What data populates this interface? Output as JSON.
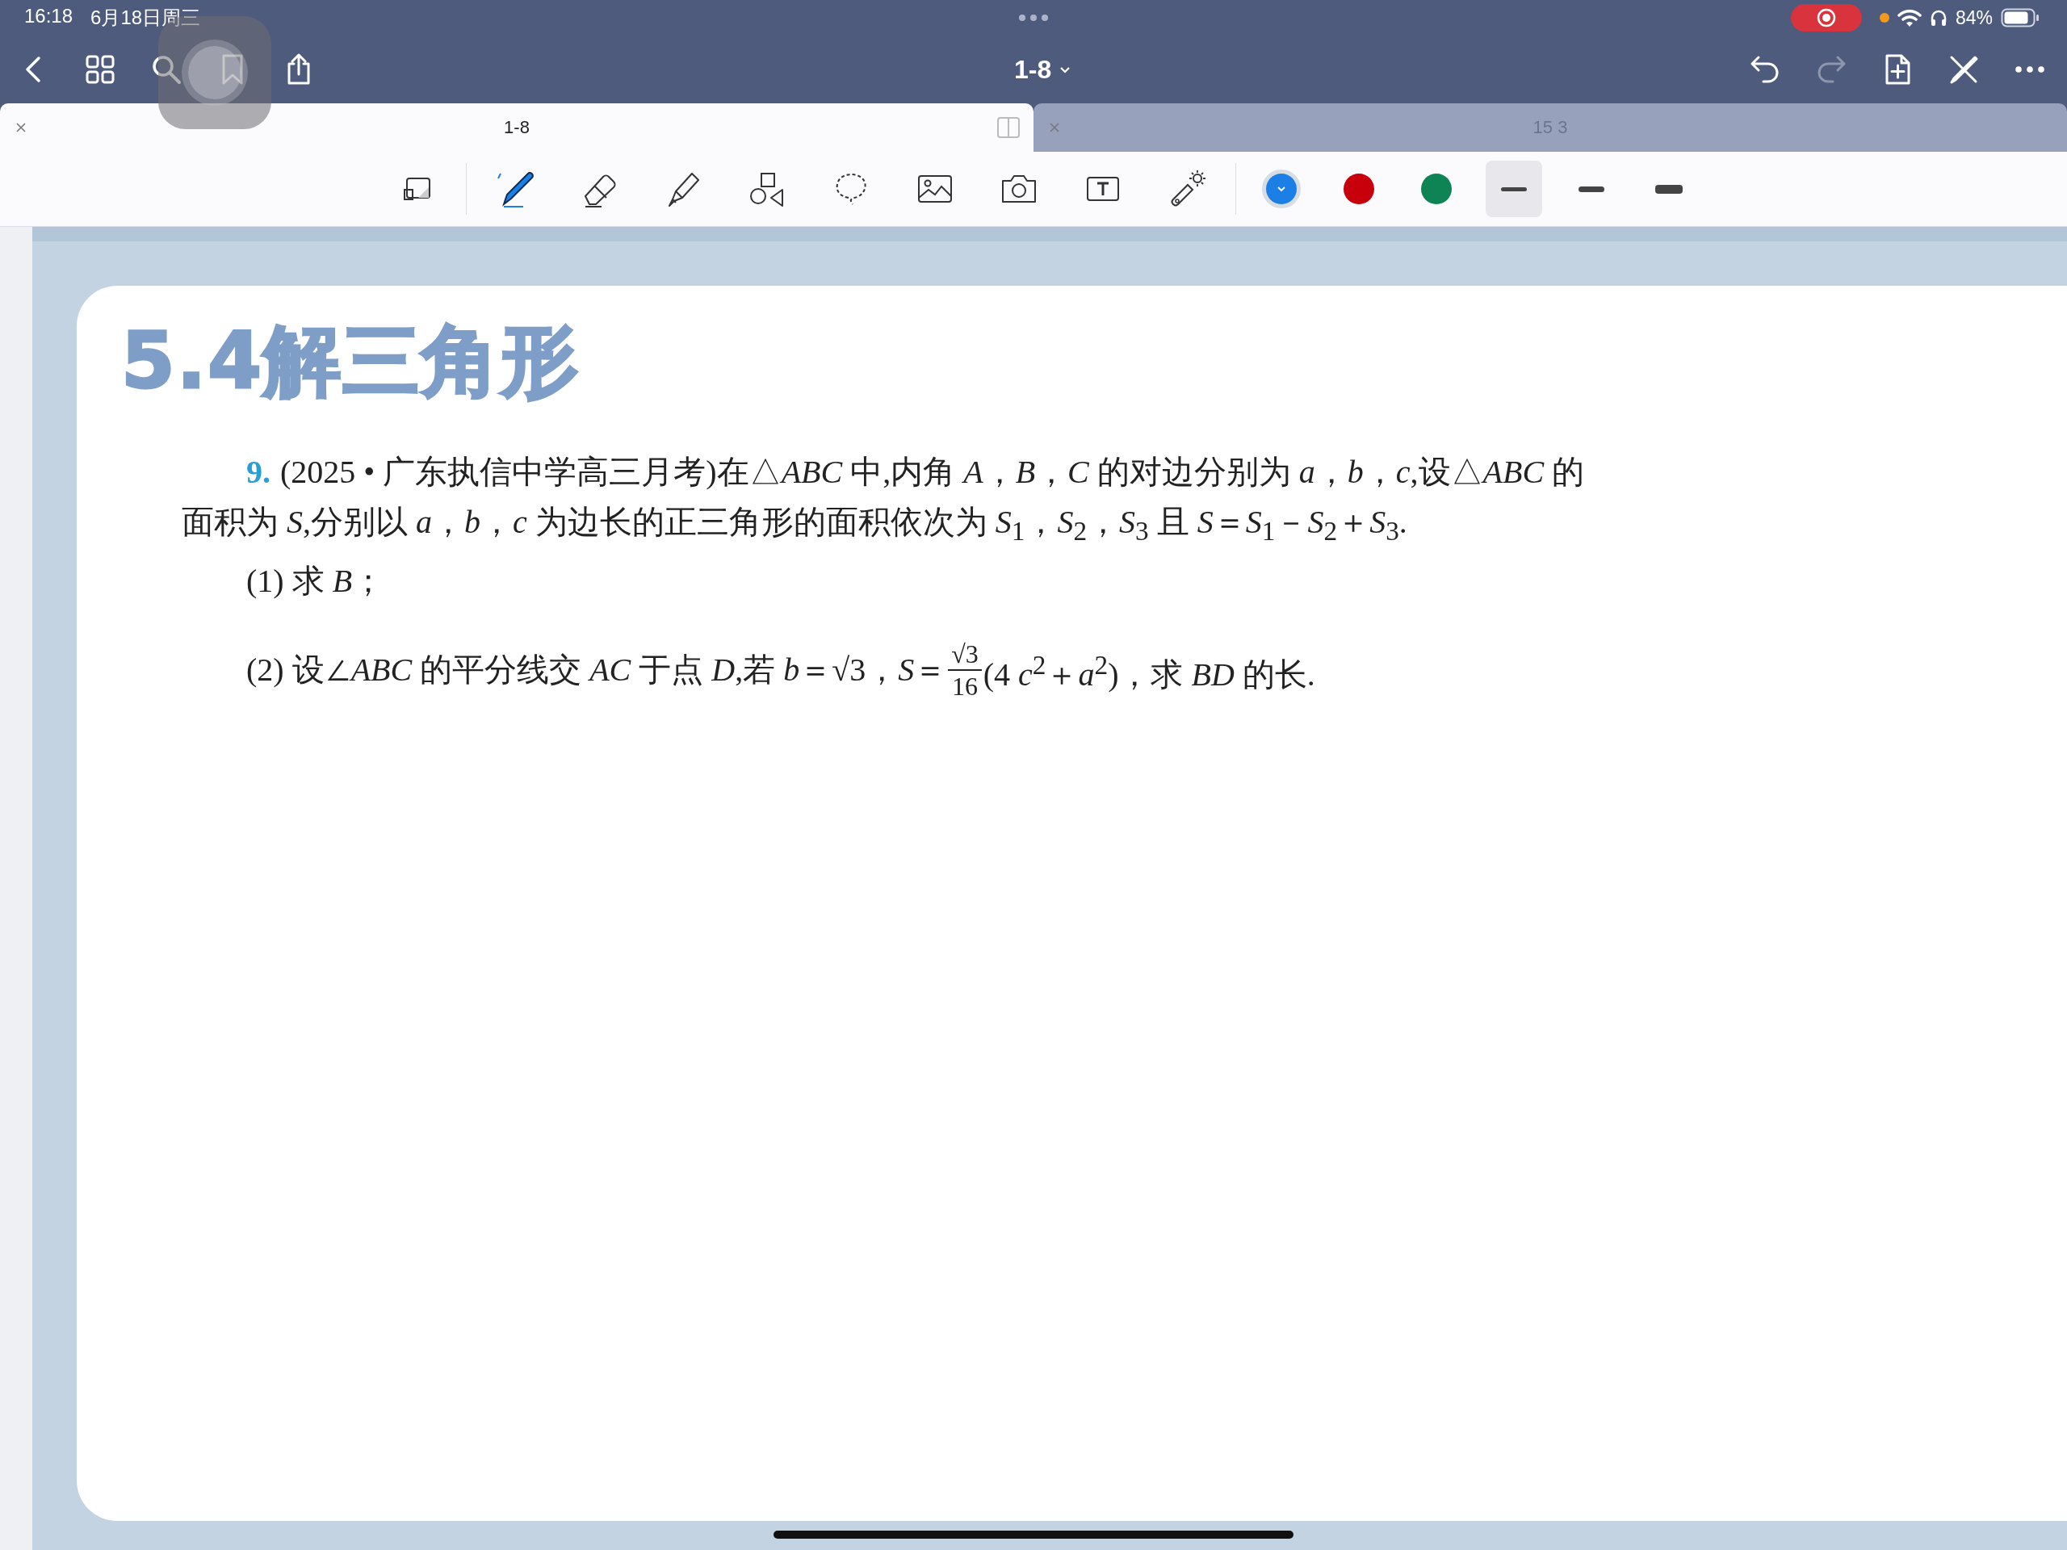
{
  "status_bar": {
    "time": "16:18",
    "date": "6月18日周三",
    "battery": "84%"
  },
  "nav": {
    "title": "1-8",
    "redo": {
      "disabled": true
    }
  },
  "tabs": [
    {
      "label": "1-8",
      "selected": true
    },
    {
      "label": "15 3",
      "selected": false
    }
  ],
  "tools": [
    {
      "kind": "zoom"
    },
    {
      "kind": "pen"
    },
    {
      "kind": "eraser"
    },
    {
      "kind": "highlighter"
    },
    {
      "kind": "shapes"
    },
    {
      "kind": "lasso"
    },
    {
      "kind": "image"
    },
    {
      "kind": "camera"
    },
    {
      "kind": "text"
    },
    {
      "kind": "laser"
    }
  ],
  "colors": [
    {
      "color": "#1b7fe6",
      "selected": true
    },
    {
      "color": "#c8000b",
      "selected": false
    },
    {
      "color": "#0e8454",
      "selected": false
    }
  ],
  "widths": [
    {
      "kind": "thin",
      "selected": true
    },
    {
      "kind": "medium",
      "selected": false
    },
    {
      "kind": "thick",
      "selected": false
    }
  ],
  "page": {
    "title": "5.4解三角形",
    "problem": {
      "number": "9.",
      "lines": [
        "(2025 • 广东执信中学高三月考)在△*ABC* 中,内角 *A*，*B*，*C* 的对边分别为 *a*，*b*，*c*,设△*ABC* 的",
        "面积为 *S*,分别以 *a*，*b*，*c* 为边长的正三角形的面积依次为 *S*$_{1}$，*S*$_{2}$，*S*$_{3}$ 且 *S*＝*S*$_{1}$－*S*$_{2}$＋*S*$_{3}$."
      ],
      "part1": "(1) 求 *B*；",
      "part2": {
        "before": "(2) 设∠*ABC* 的平分线交 *AC* 于点 *D*,若 *b*＝√3，*S*＝",
        "numerator": "√3",
        "denominator": "16",
        "after": "(4 *c*$^{2}$＋*a*$^{2}$)，求 *BD* 的长."
      }
    }
  }
}
